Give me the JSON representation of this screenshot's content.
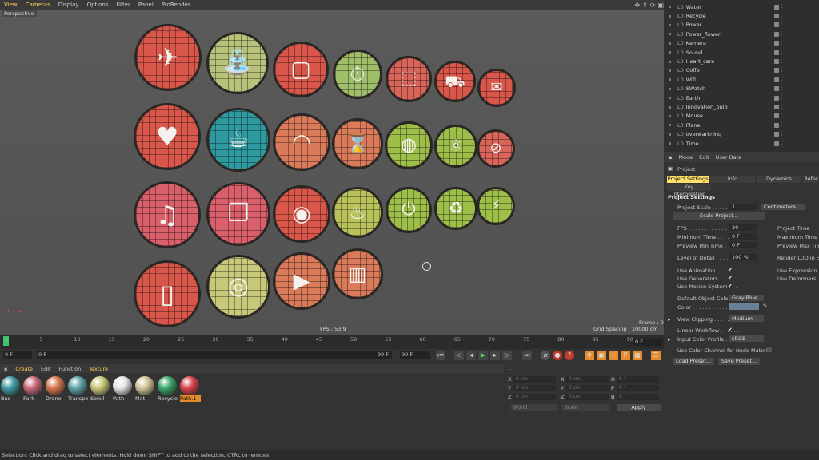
{
  "viewport": {
    "menu": [
      "View",
      "Cameras",
      "Display",
      "Options",
      "Filter",
      "Panel",
      "ProRender"
    ],
    "camera": "Perspective",
    "fps": "FPS : 53.9",
    "frame": "Frame : 0",
    "grid_spacing": "Grid Spacing : 10000 cm",
    "badges": [
      {
        "icon": "plane-icon",
        "glyph": "✈",
        "color": "#d9574a"
      },
      {
        "icon": "water-tap-icon",
        "glyph": "⛲",
        "color": "#b9c27a"
      },
      {
        "icon": "cctv-icon",
        "glyph": "▢",
        "color": "#d9574a"
      },
      {
        "icon": "stopwatch-icon",
        "glyph": "⏱",
        "color": "#9ebe6a"
      },
      {
        "icon": "box-icon",
        "glyph": "⬚",
        "color": "#d9645a"
      },
      {
        "icon": "truck-icon",
        "glyph": "⛟",
        "color": "#d9574a"
      },
      {
        "icon": "mail-icon",
        "glyph": "✉",
        "color": "#d9574a"
      },
      {
        "icon": "heart-plus-icon",
        "glyph": "♥",
        "color": "#d9574a"
      },
      {
        "icon": "coffee-icon",
        "glyph": "☕",
        "color": "#2e9aa0"
      },
      {
        "icon": "wifi-icon",
        "glyph": "◠",
        "color": "#d97a5a"
      },
      {
        "icon": "hourglass-icon",
        "glyph": "⌛",
        "color": "#d97a5a"
      },
      {
        "icon": "earth-icon",
        "glyph": "◍",
        "color": "#9ebe4a"
      },
      {
        "icon": "lightbulb-icon",
        "glyph": "☼",
        "color": "#9ebe4a"
      },
      {
        "icon": "no-smoking-icon",
        "glyph": "⊘",
        "color": "#d9645a"
      },
      {
        "icon": "music-icon",
        "glyph": "♫",
        "color": "#d9606a"
      },
      {
        "icon": "cube-icon",
        "glyph": "❒",
        "color": "#d9606a"
      },
      {
        "icon": "camera-icon",
        "glyph": "◉",
        "color": "#d9574a"
      },
      {
        "icon": "cup-icon",
        "glyph": "♨",
        "color": "#b9c25a"
      },
      {
        "icon": "power-icon",
        "glyph": "⏻",
        "color": "#9ebe4a"
      },
      {
        "icon": "recycle-icon",
        "glyph": "♻",
        "color": "#9ebe4a"
      },
      {
        "icon": "no-sound-icon",
        "glyph": "⚡",
        "color": "#9ebe4a"
      },
      {
        "icon": "smartphone-icon",
        "glyph": "▯",
        "color": "#d9574a"
      },
      {
        "icon": "washing-machine-icon",
        "glyph": "◎",
        "color": "#c8c87a"
      },
      {
        "icon": "video-play-icon",
        "glyph": "▶",
        "color": "#d97a5a"
      },
      {
        "icon": "chart-icon",
        "glyph": "▥",
        "color": "#d97a5a"
      }
    ]
  },
  "timeline": {
    "ticks": [
      "0",
      "5",
      "10",
      "15",
      "20",
      "25",
      "30",
      "35",
      "40",
      "45",
      "50",
      "55",
      "60",
      "65",
      "70",
      "75",
      "80",
      "85",
      "90"
    ],
    "current_frame": "0 F",
    "start_field": "0 F",
    "range_start": "0 F",
    "range_end": "90 F",
    "end_field": "90 F"
  },
  "materials": {
    "menu": [
      "Create",
      "Edit",
      "Function",
      "Texture"
    ],
    "items": [
      {
        "name": "Bus",
        "color": "#3f9aa6"
      },
      {
        "name": "Park",
        "color": "#c96a78"
      },
      {
        "name": "Drone",
        "color": "#d9774e"
      },
      {
        "name": "Transpo",
        "color": "#5fa3a8"
      },
      {
        "name": "Soleil",
        "color": "#c9c87a"
      },
      {
        "name": "Path",
        "color": "#e6e6e6"
      },
      {
        "name": "Mat",
        "color": "#cfc49a"
      },
      {
        "name": "Recycle",
        "color": "#3ca66a"
      },
      {
        "name": "Path.1",
        "color": "#d9444a"
      }
    ]
  },
  "coordinates": {
    "position": [
      {
        "axis": "X",
        "value": "0 cm"
      },
      {
        "axis": "Y",
        "value": "0 cm"
      },
      {
        "axis": "Z",
        "value": "0 cm"
      }
    ],
    "size": [
      {
        "axis": "X",
        "value": "0 cm"
      },
      {
        "axis": "Y",
        "value": "0 cm"
      },
      {
        "axis": "Z",
        "value": "0 cm"
      }
    ],
    "rotation": [
      {
        "axis": "H",
        "value": "0 °"
      },
      {
        "axis": "P",
        "value": "0 °"
      },
      {
        "axis": "B",
        "value": "0 °"
      }
    ],
    "mode_dropdown": "World",
    "size_dropdown": "Scale",
    "apply": "Apply",
    "header": "--"
  },
  "status_bar": "Selection: Click and drag to select elements. Hold down SHIFT to add to the selection, CTRL to remove.",
  "objects": [
    "Water",
    "Recycle",
    "Power",
    "Power_flower",
    "Kamera",
    "Sound",
    "Heart_care",
    "Coffe",
    "Wifi",
    "SWatch",
    "Earth",
    "Innovation_bulb",
    "Mouse",
    "Plane",
    "overwarkning",
    "Time"
  ],
  "attributes": {
    "menu": [
      "Mode",
      "Edit",
      "User Data"
    ],
    "title": "Project",
    "tabs": [
      "Project Settings",
      "Info",
      "Dynamics",
      "Refer"
    ],
    "subtab": "Key Interpolation",
    "section": "Project Settings",
    "project_scale_label": "Project Scale . . . . . . .",
    "project_scale_value": "1",
    "project_scale_unit": "Centimeters",
    "scale_project_button": "Scale Project...",
    "fps_label": "FPS . . . . . . . . . . . . . . . .",
    "fps_value": "30",
    "min_time_label": "Minimum Time . . . . . . .",
    "min_time_value": "0 F",
    "preview_min_label": "Preview Min Time . . . .",
    "preview_min_value": "0 F",
    "lod_label": "Level of Detail . . . . . . .",
    "lod_value": "100 %",
    "project_time_label": "Project Time",
    "max_time_label": "Maximum Time",
    "preview_max_label": "Preview Max Time",
    "render_lod_label": "Render LOD in Edit",
    "use_animation": "Use Animation . . . . . . .",
    "use_generators": "Use Generators . . . . .",
    "use_motion": "Use Motion System . . .",
    "use_expression": "Use Expression",
    "use_deformers": "Use Deformers",
    "default_obj_color_label": "Default Object Color",
    "default_obj_color_value": "Gray-Blue",
    "color_label": "Color . . . . . . . . . . . . . . .",
    "view_clipping_label": "View Clipping . . . . . . . .",
    "view_clipping_value": "Medium",
    "linear_workflow": "Linear Workflow . . . . . .",
    "input_color_label": "Input Color Profile . . . .",
    "input_color_value": "sRGB",
    "node_material": "Use Color Channel for Node Material",
    "load_preset": "Load Preset...",
    "save_preset": "Save Preset...",
    "check": "✔"
  }
}
